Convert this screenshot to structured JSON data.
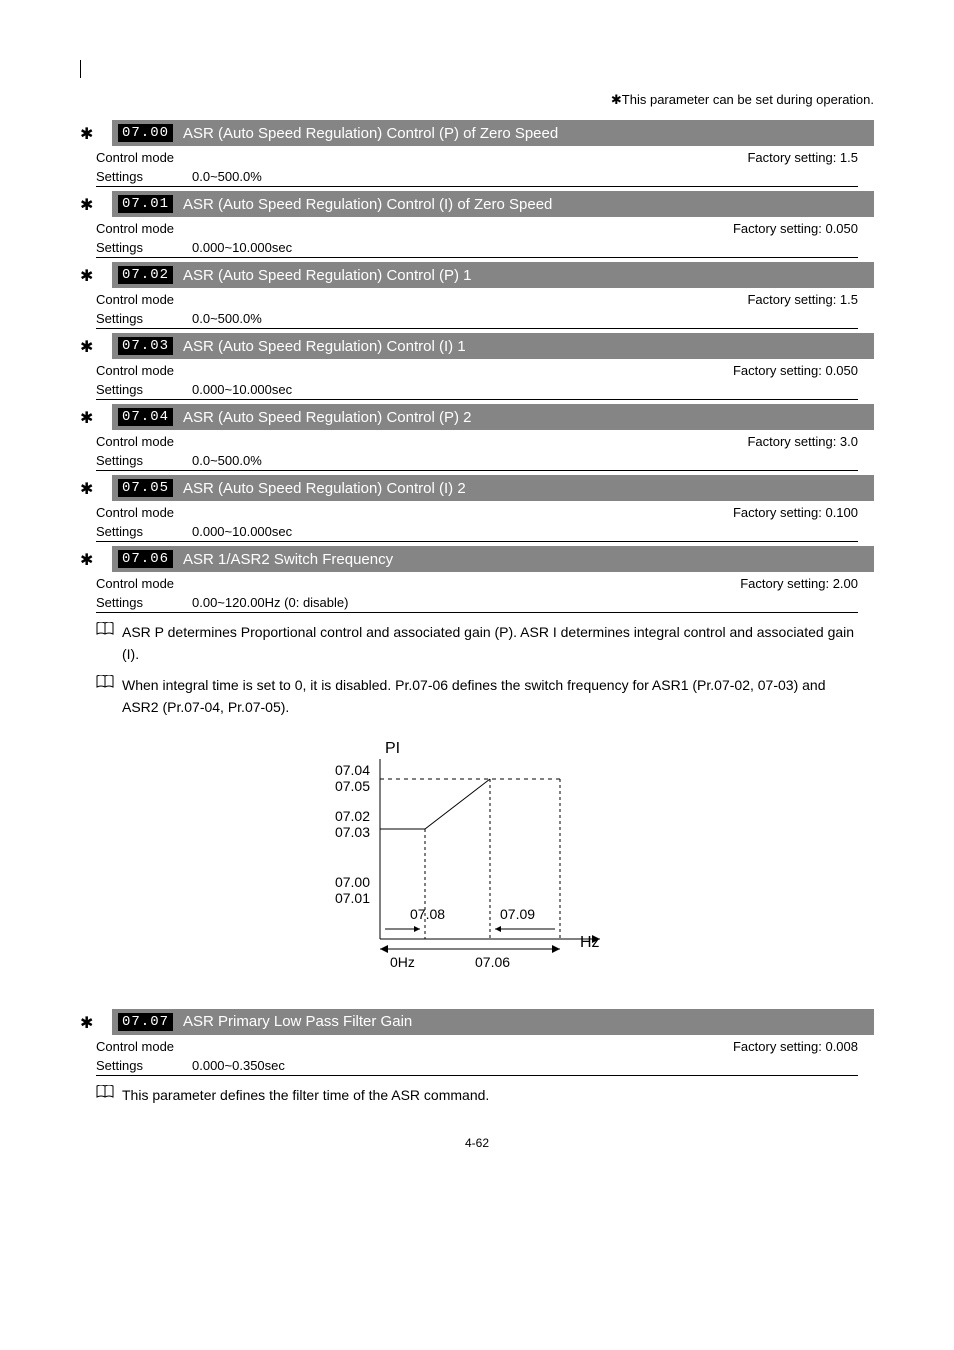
{
  "top_note": "✱This parameter can be set during operation.",
  "star_glyph": "✱",
  "book_glyph": "📖",
  "params": [
    {
      "code": "07.00",
      "title": "ASR (Auto Speed Regulation) Control (P) of Zero Speed",
      "control_mode": "Control mode",
      "factory_setting": "Factory setting: 1.5",
      "settings_label": "Settings",
      "settings_value": "0.0~500.0%"
    },
    {
      "code": "07.01",
      "title": "ASR (Auto Speed Regulation) Control (I) of Zero Speed",
      "control_mode": "Control mode",
      "factory_setting": "Factory setting: 0.050",
      "settings_label": "Settings",
      "settings_value": "0.000~10.000sec"
    },
    {
      "code": "07.02",
      "title": "ASR (Auto Speed Regulation) Control (P) 1",
      "control_mode": "Control mode",
      "factory_setting": "Factory setting: 1.5",
      "settings_label": "Settings",
      "settings_value": "0.0~500.0%"
    },
    {
      "code": "07.03",
      "title": "ASR (Auto Speed Regulation) Control (I) 1",
      "control_mode": "Control mode",
      "factory_setting": "Factory setting: 0.050",
      "settings_label": "Settings",
      "settings_value": "0.000~10.000sec"
    },
    {
      "code": "07.04",
      "title": "ASR (Auto Speed Regulation) Control (P) 2",
      "control_mode": "Control mode",
      "factory_setting": "Factory setting: 3.0",
      "settings_label": "Settings",
      "settings_value": "0.0~500.0%"
    },
    {
      "code": "07.05",
      "title": "ASR (Auto Speed Regulation) Control (I) 2",
      "control_mode": "Control mode",
      "factory_setting": "Factory setting: 0.100",
      "settings_label": "Settings",
      "settings_value": "0.000~10.000sec"
    },
    {
      "code": "07.06",
      "title": "ASR 1/ASR2 Switch Frequency",
      "control_mode": "Control mode",
      "factory_setting": "Factory setting: 2.00",
      "settings_label": "Settings",
      "settings_value": "0.00~120.00Hz (0: disable)"
    }
  ],
  "notes": [
    "ASR P determines Proportional control and associated gain (P). ASR I determines integral control and associated gain (I).",
    "When integral time is set to 0, it is disabled. Pr.07-06 defines the switch frequency for ASR1 (Pr.07-02, 07-03) and ASR2 (Pr.07-04, Pr.07-05)."
  ],
  "chart_data": {
    "type": "diagram",
    "y_title": "PI",
    "y_labels_upper": [
      "07.04",
      "07.05"
    ],
    "y_labels_mid": [
      "07.02",
      "07.03"
    ],
    "y_labels_lower": [
      "07.00",
      "07.01"
    ],
    "x_origin_label": "0Hz",
    "x_mid_label": "07.06",
    "x_axis_label": "Hz",
    "range_left_label": "07.08",
    "range_right_label": "07.09"
  },
  "bottom_param": {
    "code": "07.07",
    "title": "ASR Primary Low Pass Filter Gain",
    "control_mode": "Control mode",
    "factory_setting": "Factory setting: 0.008",
    "settings_label": "Settings",
    "settings_value": "0.000~0.350sec"
  },
  "bottom_note": "This parameter defines the filter time of the ASR command.",
  "page_number": "4-62"
}
